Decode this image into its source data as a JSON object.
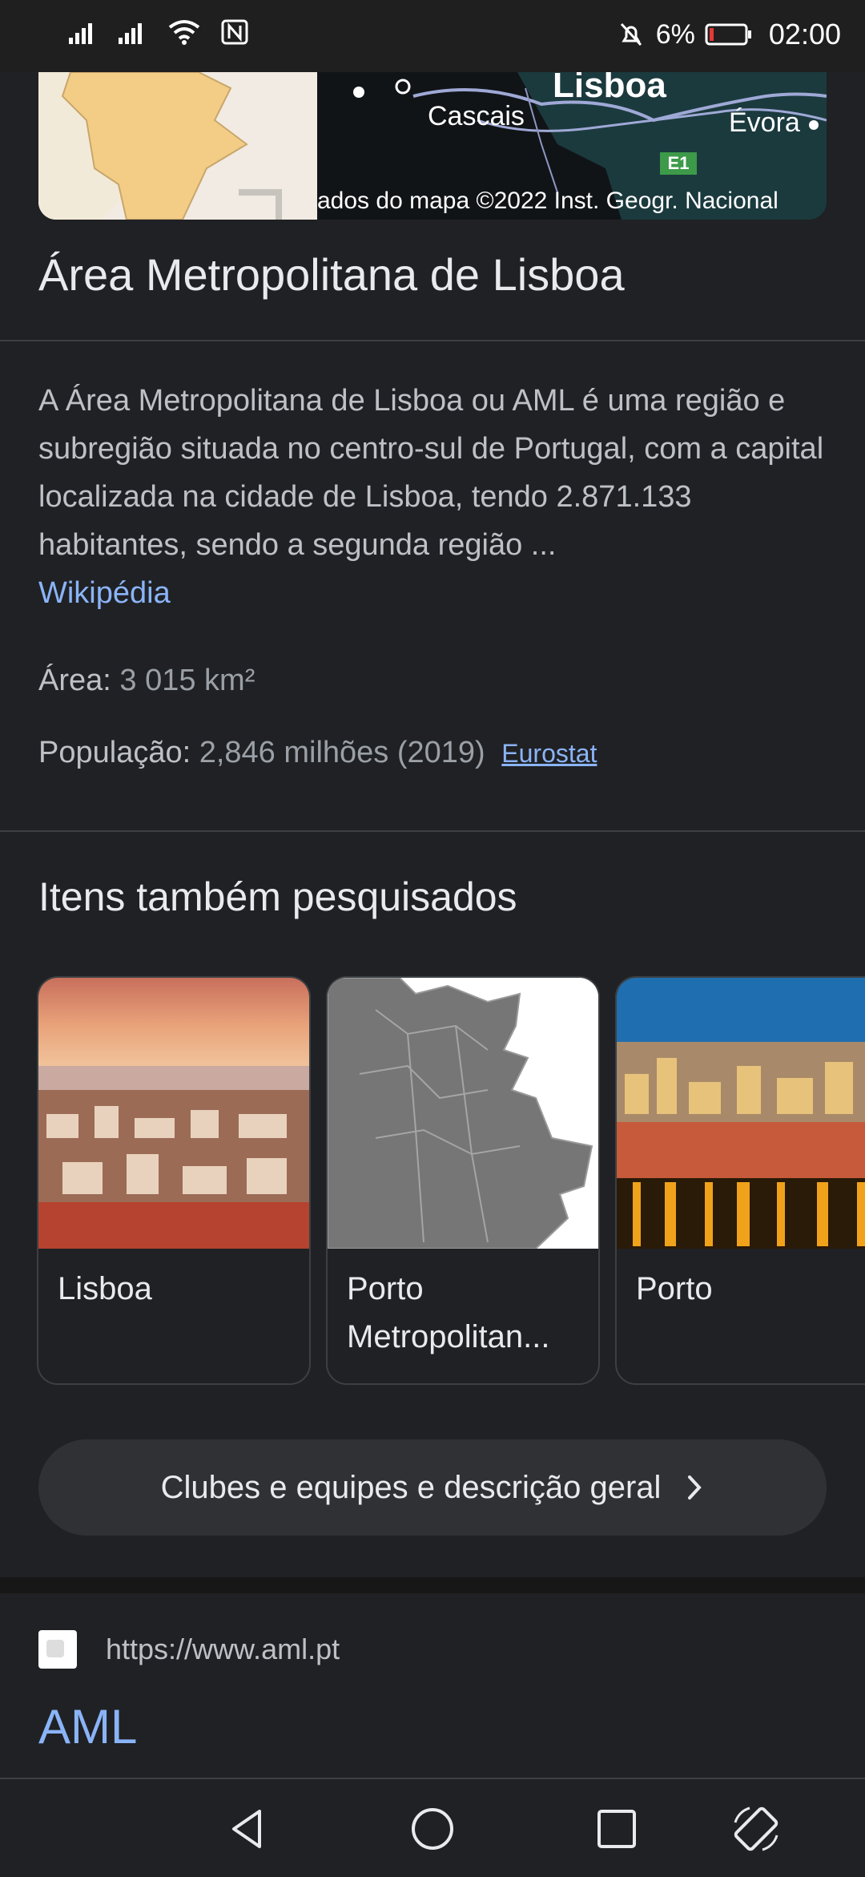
{
  "status_bar": {
    "battery": "6%",
    "time": "02:00"
  },
  "map": {
    "labels": {
      "lisboa": "Lisboa",
      "cascais": "Cascais",
      "evora": "Évora",
      "road": "E1"
    },
    "credit": "ados do mapa ©2022 Inst. Geogr. Nacional"
  },
  "title": "Área Metropolitana de Lisboa",
  "description": {
    "text": "A Área Metropolitana de Lisboa ou AML é uma região e subregião situada no centro-sul de Portugal, com a capital localizada na cidade de Lisboa, tendo 2.871.133 habitantes, sendo a segunda região ...",
    "source": "Wikipédia"
  },
  "facts": {
    "area_label": "Área:",
    "area_value": "3 015 km²",
    "population_label": "População:",
    "population_value": "2,846 milhões (2019)",
    "population_source": "Eurostat"
  },
  "also_searched": {
    "heading": "Itens também pesquisados",
    "items": [
      {
        "label": "Lisboa"
      },
      {
        "label": "Porto Metropolitan..."
      },
      {
        "label": "Porto"
      }
    ]
  },
  "overview_button": "Clubes e equipes e descrição geral",
  "result": {
    "url": "https://www.aml.pt",
    "title": "AML"
  },
  "colors": {
    "background": "#202124",
    "link": "#8ab4f8",
    "text": "#e8eaed",
    "muted": "#bdc1c6"
  }
}
